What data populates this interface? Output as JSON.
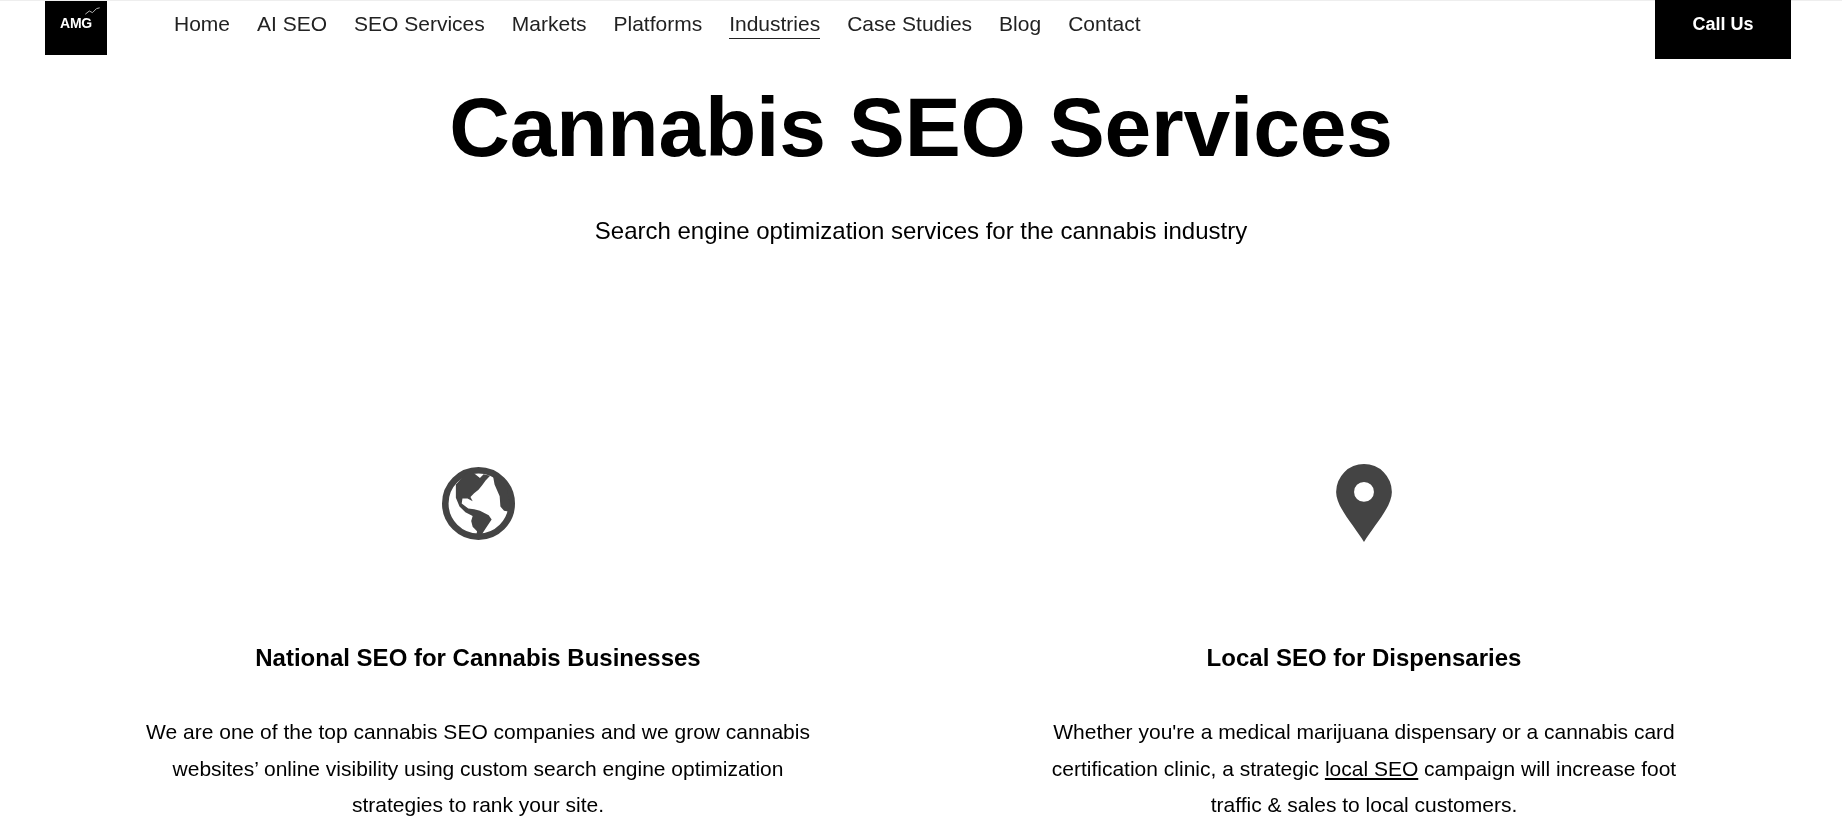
{
  "header": {
    "logo": {
      "text": "AMG"
    },
    "nav": [
      {
        "label": "Home",
        "selected": false
      },
      {
        "label": "AI SEO",
        "selected": false
      },
      {
        "label": "SEO Services",
        "selected": false
      },
      {
        "label": "Markets",
        "selected": false
      },
      {
        "label": "Platforms",
        "selected": false
      },
      {
        "label": "Industries",
        "selected": true
      },
      {
        "label": "Case Studies",
        "selected": false
      },
      {
        "label": "Blog",
        "selected": false
      },
      {
        "label": "Contact",
        "selected": false
      }
    ],
    "cta": {
      "label": "Call Us"
    }
  },
  "hero": {
    "title": "Cannabis SEO Services",
    "subtitle": "Search engine optimization services for the cannabis industry"
  },
  "features": [
    {
      "title": "National SEO for Cannabis Businesses",
      "body": [
        {
          "kind": "text",
          "text": "We are one of the top cannabis SEO companies and we grow cannabis websites’ online visibility using custom search engine optimization strategies to rank your site."
        }
      ]
    },
    {
      "title": "Local SEO for Dispensaries",
      "body": [
        {
          "kind": "text",
          "text": "Whether you're a medical marijuana dispensary or a cannabis card certification clinic, a strategic "
        },
        {
          "kind": "link",
          "text": "local SEO"
        },
        {
          "kind": "text",
          "text": " campaign will increase foot traffic & sales to local customers."
        }
      ]
    }
  ]
}
